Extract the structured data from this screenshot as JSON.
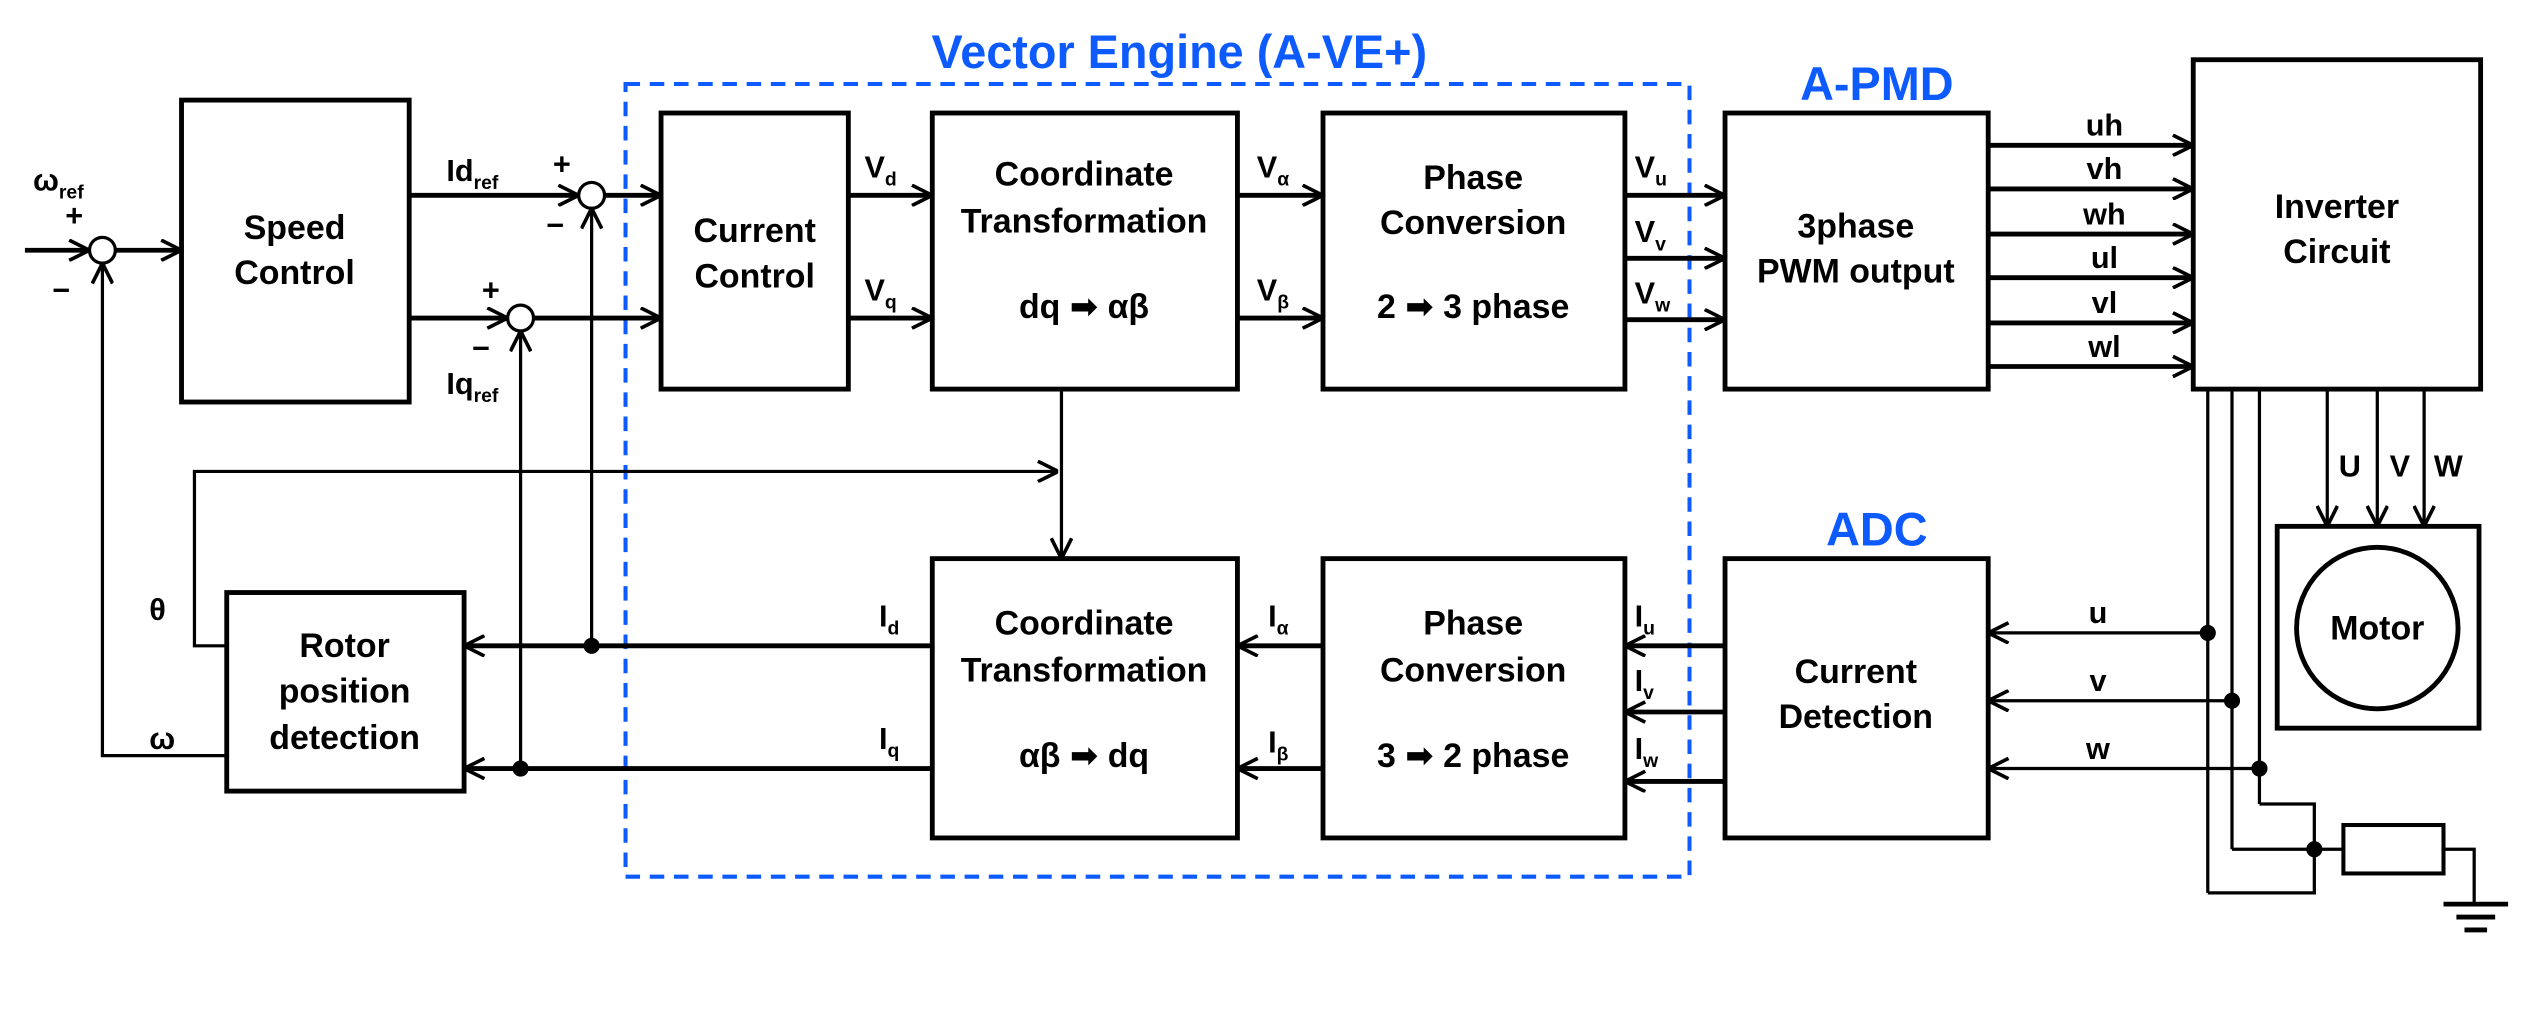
{
  "colors": {
    "accent": "#0d5bff",
    "line": "#000000"
  },
  "groups": {
    "vector_engine": "Vector Engine (A-VE+)",
    "apmd": "A-PMD",
    "adc": "ADC"
  },
  "blocks": {
    "speed_control": [
      "Speed",
      "Control"
    ],
    "current_control": [
      "Current",
      "Control"
    ],
    "coord_top": [
      "Coordinate",
      "Transformation",
      "dq ➡ αβ"
    ],
    "phase_top": [
      "Phase",
      "Conversion",
      "2 ➡ 3 phase"
    ],
    "pwm": [
      "3phase",
      "PWM output"
    ],
    "inverter": [
      "Inverter",
      "Circuit"
    ],
    "motor": "Motor",
    "current_detection": [
      "Current",
      "Detection"
    ],
    "coord_bottom": [
      "Coordinate",
      "Transformation",
      "αβ ➡ dq"
    ],
    "phase_bottom": [
      "Phase",
      "Conversion",
      "3 ➡ 2 phase"
    ],
    "rotor": [
      "Rotor",
      "position",
      "detection"
    ]
  },
  "signals": {
    "omega_ref": {
      "main": "ω",
      "sub": "ref"
    },
    "id_ref": {
      "main": "Id",
      "sub": "ref"
    },
    "iq_ref": {
      "main": "Iq",
      "sub": "ref"
    },
    "plus": "+",
    "minus": "−",
    "vd": {
      "main": "V",
      "sub": "d"
    },
    "vq": {
      "main": "V",
      "sub": "q"
    },
    "valpha": {
      "main": "V",
      "sub": "α"
    },
    "vbeta": {
      "main": "V",
      "sub": "β"
    },
    "vu": {
      "main": "V",
      "sub": "u"
    },
    "vv": {
      "main": "V",
      "sub": "v"
    },
    "vw": {
      "main": "V",
      "sub": "w"
    },
    "gates": [
      "uh",
      "vh",
      "wh",
      "ul",
      "vl",
      "wl"
    ],
    "phases_out": [
      "U",
      "V",
      "W"
    ],
    "phases_in": [
      "u",
      "v",
      "w"
    ],
    "iu": {
      "main": "I",
      "sub": "u"
    },
    "iv": {
      "main": "I",
      "sub": "v"
    },
    "iw": {
      "main": "I",
      "sub": "w"
    },
    "ialpha": {
      "main": "I",
      "sub": "α"
    },
    "ibeta": {
      "main": "I",
      "sub": "β"
    },
    "id": {
      "main": "I",
      "sub": "d"
    },
    "iq": {
      "main": "I",
      "sub": "q"
    },
    "theta": "θ",
    "omega": "ω"
  }
}
